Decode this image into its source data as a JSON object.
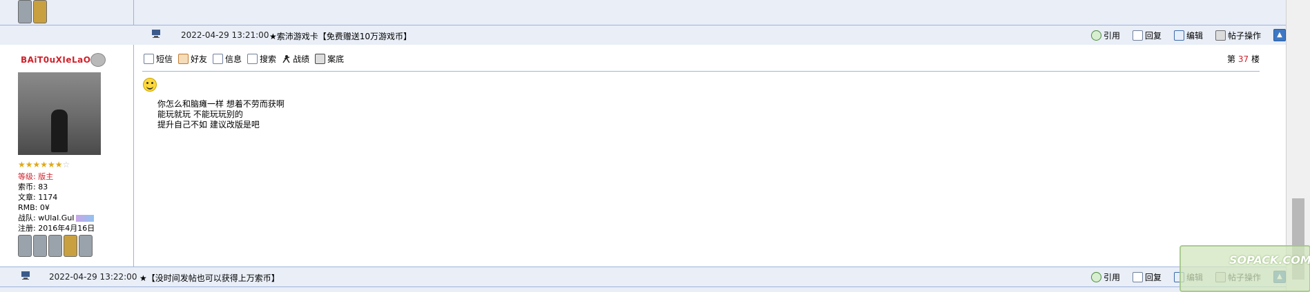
{
  "top_row": {
    "partial_text": "...  一 ..."
  },
  "sep1": {
    "date": "2022-04-29 13:21:00",
    "title": "★索沛游戏卡【免费赠送10万游戏币】"
  },
  "actions": [
    {
      "label": "引用",
      "icon": "quote-icon"
    },
    {
      "label": "回复",
      "icon": "reply-icon"
    },
    {
      "label": "编辑",
      "icon": "edit-icon"
    },
    {
      "label": "帖子操作",
      "icon": "post-ops-icon"
    }
  ],
  "post": {
    "username": "BAiT0uXIeLaO",
    "stars": "★★★★★★",
    "stars_empty": "☆",
    "info": {
      "rank_label": "等级:",
      "rank": "版主",
      "coins_label": "索币:",
      "coins": "83",
      "articles_label": "文章:",
      "articles": "1174",
      "rmb_label": "RMB:",
      "rmb": "0¥",
      "team_label": "战队:",
      "team": "wUlaI.GuI",
      "reg_label": "注册:",
      "reg": "2016年4月16日"
    },
    "toolbar": [
      "短信",
      "好友",
      "信息",
      "搜索",
      "战绩",
      "案底"
    ],
    "floor_prefix": "第",
    "floor_num": "37",
    "floor_suffix": "楼",
    "lines": [
      "你怎么和脑瘫一样 想着不劳而获啊",
      "能玩就玩 不能玩玩别的",
      "提升自己不如 建议改版是吧"
    ]
  },
  "sep2": {
    "date": "2022-04-29 13:22:00",
    "title": "★【没时间发帖也可以获得上万索币】"
  },
  "watermark": {
    "text": "SOPACK.COM"
  }
}
